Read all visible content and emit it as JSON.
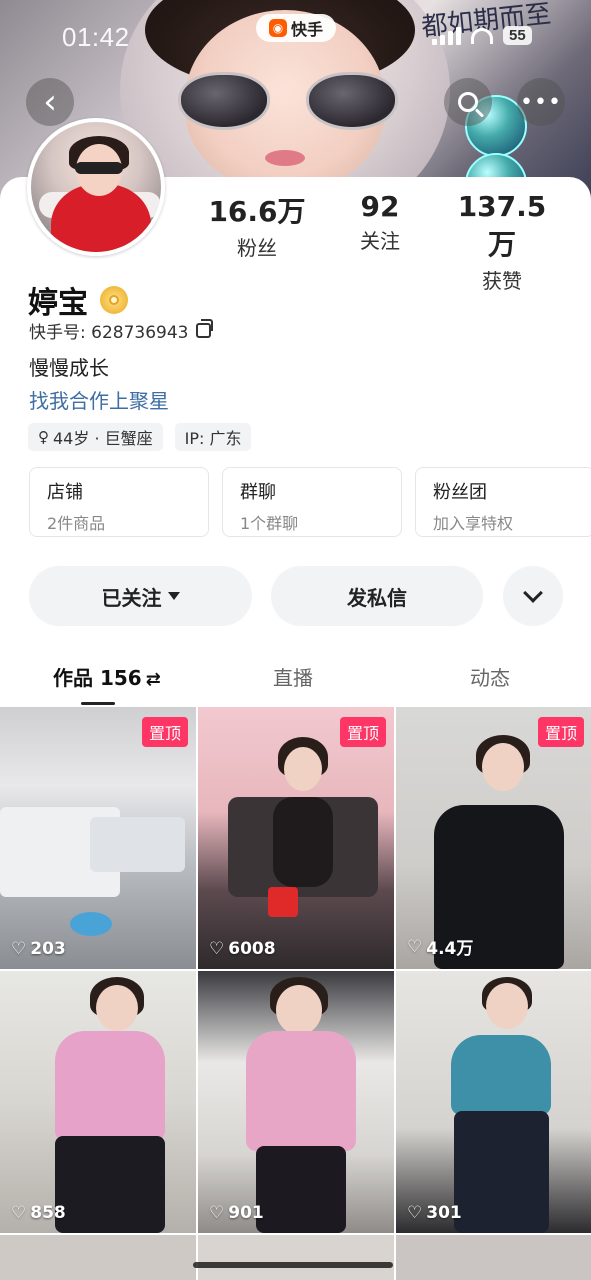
{
  "status_bar": {
    "time": "01:42",
    "battery": "55"
  },
  "app": {
    "name": "快手"
  },
  "banner": {
    "handwriting": "都如期而至"
  },
  "profile": {
    "name": "婷宝",
    "kuaishou_id_label": "快手号: ",
    "kuaishou_id": "628736943",
    "bio": "慢慢成长",
    "cooperation_link": "找我合作上聚星",
    "stats": [
      {
        "value": "16.6万",
        "label": "粉丝"
      },
      {
        "value": "92",
        "label": "关注"
      },
      {
        "value": "137.5万",
        "label": "获赞"
      }
    ],
    "tags": [
      {
        "icon": "female-icon",
        "text": "44岁 · 巨蟹座"
      },
      {
        "text": "IP: 广东"
      }
    ]
  },
  "entries": [
    {
      "title": "店铺",
      "subtitle": "2件商品"
    },
    {
      "title": "群聊",
      "subtitle": "1个群聊"
    },
    {
      "title": "粉丝团",
      "subtitle": "加入享特权"
    }
  ],
  "actions": {
    "follow": "已关注",
    "message": "发私信"
  },
  "tabs": [
    {
      "label": "作品 156",
      "active": true
    },
    {
      "label": "直播",
      "active": false
    },
    {
      "label": "动态",
      "active": false
    }
  ],
  "videos": [
    {
      "likes": "203",
      "pinned": true,
      "pin_label": "置顶"
    },
    {
      "likes": "6008",
      "pinned": true,
      "pin_label": "置顶"
    },
    {
      "likes": "4.4万",
      "pinned": true,
      "pin_label": "置顶"
    },
    {
      "likes": "858",
      "pinned": false
    },
    {
      "likes": "901",
      "pinned": false
    },
    {
      "likes": "301",
      "pinned": false
    }
  ],
  "colors": {
    "pin_red": "#fe3666",
    "link_blue": "#3f6ea3",
    "brand_orange": "#ff5b00"
  }
}
